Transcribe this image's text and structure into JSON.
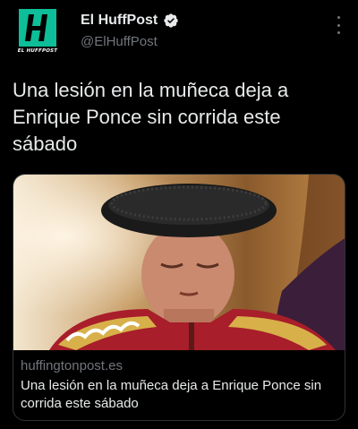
{
  "account": {
    "display_name": "El HuffPost",
    "handle": "@ElHuffPost",
    "verified": true,
    "avatar_caption": "EL HUFFPOST",
    "avatar_color": "#0dbe98"
  },
  "tweet": {
    "text": "Una lesión en la muñeca deja a Enrique Ponce sin corrida este sábado"
  },
  "link_card": {
    "domain": "huffingtonpost.es",
    "title": "Una lesión en la muñeca deja a Enrique Ponce sin corrida este sábado",
    "image_description_icon": "photo-matador"
  },
  "colors": {
    "background": "#000000",
    "text_primary": "#e7e9ea",
    "text_secondary": "#71767b",
    "verified_blue": "#1d9bf0",
    "border": "#2f3336"
  }
}
